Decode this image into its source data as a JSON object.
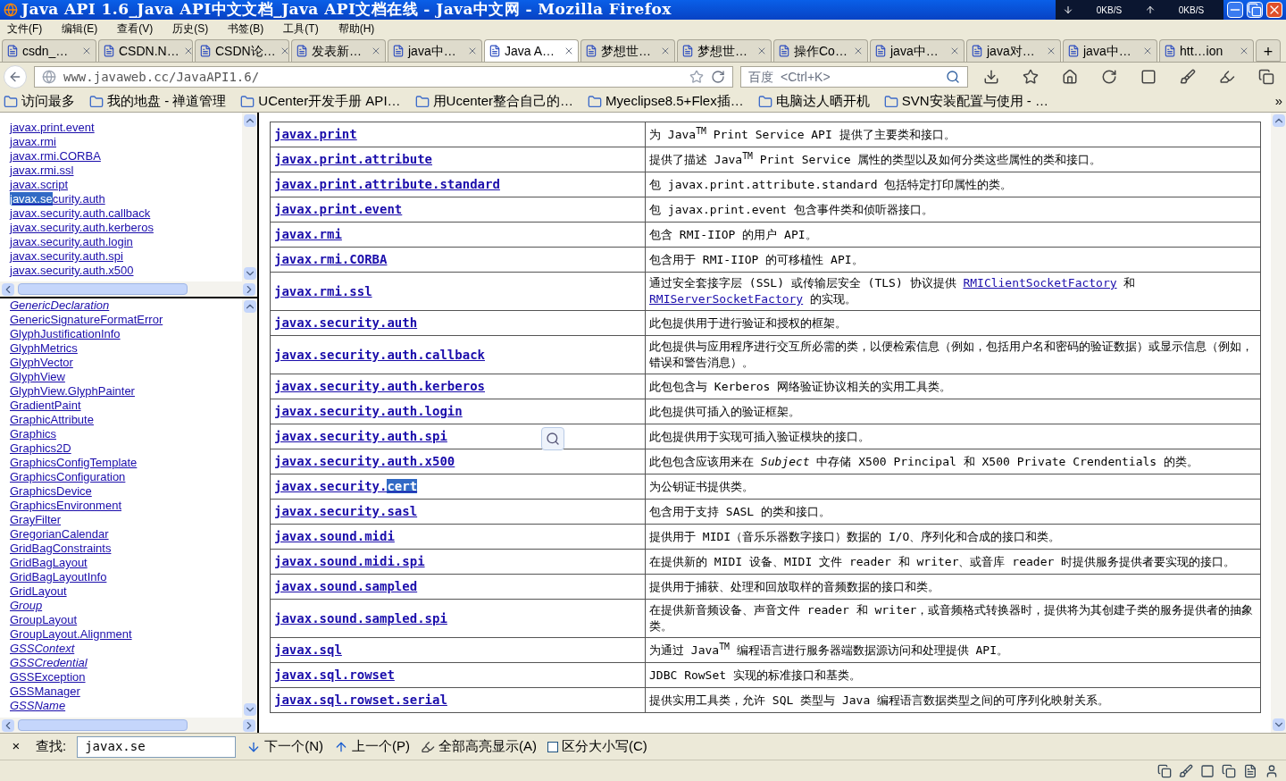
{
  "window": {
    "title": "Java API 1.6_Java API中文文档_Java API文档在线 - Java中文网 - Mozilla Firefox",
    "download_speed": "0KB/S",
    "upload_speed": "0KB/S"
  },
  "menu": [
    "文件(F)",
    "编辑(E)",
    "查看(V)",
    "历史(S)",
    "书签(B)",
    "工具(T)",
    "帮助(H)"
  ],
  "tabs": [
    {
      "label": "csdn_…",
      "selected": false
    },
    {
      "label": "CSDN.N…",
      "selected": false
    },
    {
      "label": "CSDN论…",
      "selected": false
    },
    {
      "label": "发表新…",
      "selected": false
    },
    {
      "label": "java中…",
      "selected": false
    },
    {
      "label": "Java A…",
      "selected": true
    },
    {
      "label": "梦想世…",
      "selected": false
    },
    {
      "label": "梦想世…",
      "selected": false
    },
    {
      "label": "操作Co…",
      "selected": false
    },
    {
      "label": "java中…",
      "selected": false
    },
    {
      "label": "java对…",
      "selected": false
    },
    {
      "label": "java中…",
      "selected": false
    },
    {
      "label": "htt…ion",
      "selected": false
    }
  ],
  "new_tab": "+",
  "address": {
    "value": "www.javaweb.cc/JavaAPI1.6/"
  },
  "search": {
    "engine": "百度",
    "placeholder": "<Ctrl+K>"
  },
  "bookmarks": [
    "访问最多",
    "我的地盘 - 禅道管理",
    "UCenter开发手册 API…",
    "用Ucenter整合自己的…",
    "Myeclipse8.5+Flex插…",
    "电脑达人晒开机",
    "SVN安装配置与使用 - …"
  ],
  "bookmarks_more": "»",
  "packages_frame": {
    "items": [
      {
        "text": "javax.print.event"
      },
      {
        "text": "javax.rmi"
      },
      {
        "text": "javax.rmi.CORBA"
      },
      {
        "text": "javax.rmi.ssl"
      },
      {
        "text": "javax.script"
      },
      {
        "parts": [
          {
            "text": "javax.se",
            "highlighted": true
          },
          {
            "text": "curity.auth",
            "highlighted": false
          }
        ]
      },
      {
        "text": "javax.security.auth.callback"
      },
      {
        "text": "javax.security.auth.kerberos"
      },
      {
        "text": "javax.security.auth.login"
      },
      {
        "text": "javax.security.auth.spi"
      },
      {
        "text": "javax.security.auth.x500"
      }
    ]
  },
  "classes_frame": {
    "items": [
      {
        "text": "GenericDeclaration",
        "italic": true
      },
      {
        "text": "GenericSignatureFormatError",
        "italic": false
      },
      {
        "text": "GlyphJustificationInfo",
        "italic": false
      },
      {
        "text": "GlyphMetrics",
        "italic": false
      },
      {
        "text": "GlyphVector",
        "italic": false
      },
      {
        "text": "GlyphView",
        "italic": false
      },
      {
        "text": "GlyphView.GlyphPainter",
        "italic": false
      },
      {
        "text": "GradientPaint",
        "italic": false
      },
      {
        "text": "GraphicAttribute",
        "italic": false
      },
      {
        "text": "Graphics",
        "italic": false
      },
      {
        "text": "Graphics2D",
        "italic": false
      },
      {
        "text": "GraphicsConfigTemplate",
        "italic": false
      },
      {
        "text": "GraphicsConfiguration",
        "italic": false
      },
      {
        "text": "GraphicsDevice",
        "italic": false
      },
      {
        "text": "GraphicsEnvironment",
        "italic": false
      },
      {
        "text": "GrayFilter",
        "italic": false
      },
      {
        "text": "GregorianCalendar",
        "italic": false
      },
      {
        "text": "GridBagConstraints",
        "italic": false
      },
      {
        "text": "GridBagLayout",
        "italic": false
      },
      {
        "text": "GridBagLayoutInfo",
        "italic": false
      },
      {
        "text": "GridLayout",
        "italic": false
      },
      {
        "text": "Group",
        "italic": true
      },
      {
        "text": "GroupLayout",
        "italic": false
      },
      {
        "text": "GroupLayout.Alignment",
        "italic": false
      },
      {
        "text": "GSSContext",
        "italic": true
      },
      {
        "text": "GSSCredential",
        "italic": true
      },
      {
        "text": "GSSException",
        "italic": false
      },
      {
        "text": "GSSManager",
        "italic": false
      },
      {
        "text": "GSSName",
        "italic": true
      }
    ]
  },
  "table": {
    "rows": [
      {
        "package": {
          "text": "javax.print"
        },
        "description": "为 Java$^{TM}$ Print Service API 提供了主要类和接口。"
      },
      {
        "package": {
          "text": "javax.print.attribute"
        },
        "description": "提供了描述 Java$^{TM}$ Print Service 属性的类型以及如何分类这些属性的类和接口。"
      },
      {
        "package": {
          "text": "javax.print.attribute.standard"
        },
        "description": "包 javax.print.attribute.standard 包括特定打印属性的类。"
      },
      {
        "package": {
          "text": "javax.print.event"
        },
        "description": "包 javax.print.event 包含事件类和侦听器接口。"
      },
      {
        "package": {
          "text": "javax.rmi"
        },
        "description": "包含 RMI-IIOP 的用户 API。"
      },
      {
        "package": {
          "text": "javax.rmi.CORBA"
        },
        "description": "包含用于 RMI-IIOP 的可移植性 API。"
      },
      {
        "package": {
          "text": "javax.rmi.ssl"
        },
        "segments": [
          {
            "kind": "text",
            "text": "通过安全套接字层 (SSL) 或传输层安全 (TLS) 协议提供 "
          },
          {
            "kind": "link",
            "text": "RMIClientSocketFactory"
          },
          {
            "kind": "text",
            "text": " 和 "
          },
          {
            "kind": "link",
            "text": "RMIServerSocketFactory"
          },
          {
            "kind": "text",
            "text": " 的实现。"
          }
        ]
      },
      {
        "package": {
          "text": "javax.security.auth"
        },
        "description": "此包提供用于进行验证和授权的框架。"
      },
      {
        "package": {
          "text": "javax.security.auth.callback"
        },
        "description": "此包提供与应用程序进行交互所必需的类，以便检索信息（例如，包括用户名和密码的验证数据）或显示信息（例如，错误和警告消息）。"
      },
      {
        "package": {
          "text": "javax.security.auth.kerberos"
        },
        "description": "此包包含与 Kerberos 网络验证协议相关的实用工具类。"
      },
      {
        "package": {
          "text": "javax.security.auth.login"
        },
        "description": "此包提供可插入的验证框架。"
      },
      {
        "package": {
          "text": "javax.security.auth.spi"
        },
        "description": "此包提供用于实现可插入验证模块的接口。"
      },
      {
        "package": {
          "text": "javax.security.auth.x500"
        },
        "description": "此包包含应该用来在 *Subject* 中存储 X500 Principal 和 X500 Private Crendentials 的类。"
      },
      {
        "package": {
          "parts": [
            {
              "text": "javax.security.",
              "highlighted": false
            },
            {
              "text": "cert",
              "highlighted": true
            }
          ]
        },
        "description": "为公钥证书提供类。"
      },
      {
        "package": {
          "text": "javax.security.sasl"
        },
        "description": "包含用于支持 SASL 的类和接口。"
      },
      {
        "package": {
          "text": "javax.sound.midi"
        },
        "description": "提供用于 MIDI（音乐乐器数字接口）数据的 I/O、序列化和合成的接口和类。"
      },
      {
        "package": {
          "text": "javax.sound.midi.spi"
        },
        "description": "在提供新的 MIDI 设备、MIDI 文件 reader 和 writer、或音库 reader 时提供服务提供者要实现的接口。"
      },
      {
        "package": {
          "text": "javax.sound.sampled"
        },
        "description": "提供用于捕获、处理和回放取样的音频数据的接口和类。"
      },
      {
        "package": {
          "text": "javax.sound.sampled.spi"
        },
        "description": "在提供新音频设备、声音文件 reader 和 writer，或音频格式转换器时，提供将为其创建子类的服务提供者的抽象类。"
      },
      {
        "package": {
          "text": "javax.sql"
        },
        "description": "为通过 Java$^{TM}$ 编程语言进行服务器端数据源访问和处理提供 API。"
      },
      {
        "package": {
          "text": "javax.sql.rowset"
        },
        "description": "JDBC RowSet 实现的标准接口和基类。"
      },
      {
        "package": {
          "text": "javax.sql.rowset.serial"
        },
        "description": "提供实用工具类，允许 SQL 类型与 Java 编程语言数据类型之间的可序列化映射关系。"
      }
    ]
  },
  "find_bar": {
    "close": "×",
    "label": "查找:",
    "value": "javax.se",
    "next": "下一个(N)",
    "previous": "上一个(P)",
    "highlight_all": "全部高亮显示(A)",
    "match_case": {
      "label": "区分大小写(C)",
      "checked": false
    }
  }
}
